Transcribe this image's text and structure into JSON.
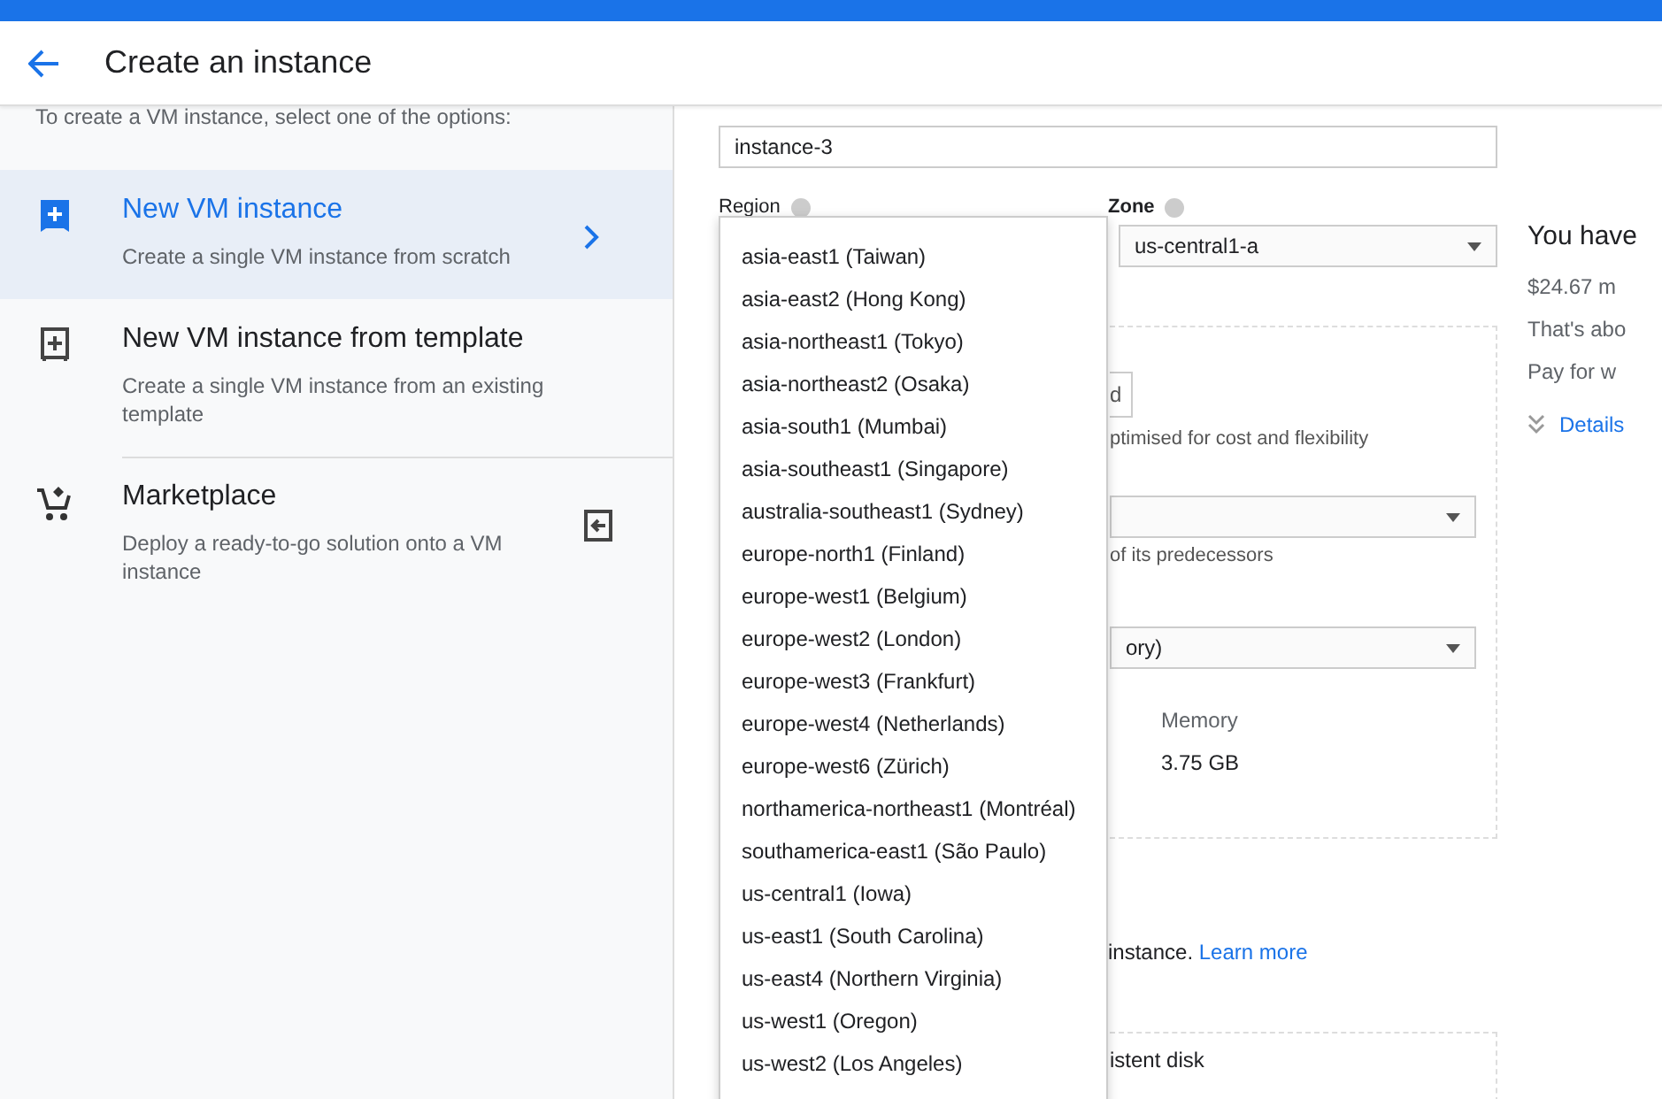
{
  "header": {
    "title": "Create an instance"
  },
  "sidebar": {
    "intro": "To create a VM instance, select one of the options:",
    "options": [
      {
        "kind": "new",
        "title": "New VM instance",
        "description": "Create a single VM instance from scratch",
        "selected": true
      },
      {
        "kind": "template",
        "title": "New VM instance from template",
        "description": "Create a single VM instance from an existing template",
        "selected": false
      },
      {
        "kind": "marketplace",
        "title": "Marketplace",
        "description": "Deploy a ready-to-go solution onto a VM instance",
        "selected": false
      }
    ]
  },
  "form": {
    "name_field": {
      "value": "instance-3"
    },
    "region": {
      "label": "Region"
    },
    "zone": {
      "label": "Zone",
      "value": "us-central1-a"
    },
    "region_menu": {
      "items": [
        "asia-east1 (Taiwan)",
        "asia-east2 (Hong Kong)",
        "asia-northeast1 (Tokyo)",
        "asia-northeast2 (Osaka)",
        "asia-south1 (Mumbai)",
        "asia-southeast1 (Singapore)",
        "australia-southeast1 (Sydney)",
        "europe-north1 (Finland)",
        "europe-west1 (Belgium)",
        "europe-west2 (London)",
        "europe-west3 (Frankfurt)",
        "europe-west4 (Netherlands)",
        "europe-west6 (Zürich)",
        "northamerica-northeast1 (Montréal)",
        "southamerica-east1 (São Paulo)",
        "us-central1 (Iowa)",
        "us-east1 (South Carolina)",
        "us-east4 (Northern Virginia)",
        "us-west1 (Oregon)",
        "us-west2 (Los Angeles)"
      ]
    },
    "machine_card": {
      "button_fragment": "d",
      "series_note": "ptimised for cost and flexibility",
      "generation_note": "of its predecessors",
      "machine_type_fragment": "ory)",
      "memory_label": "Memory",
      "memory_value": "3.75 GB"
    },
    "learn": {
      "text": "instance.",
      "link": "Learn more"
    },
    "disk_card": {
      "text": "istent disk"
    }
  },
  "pricing": {
    "heading": "You have",
    "price": "$24.67 m",
    "line_1": "That's abo",
    "line_2": "Pay for w",
    "details": "Details"
  }
}
